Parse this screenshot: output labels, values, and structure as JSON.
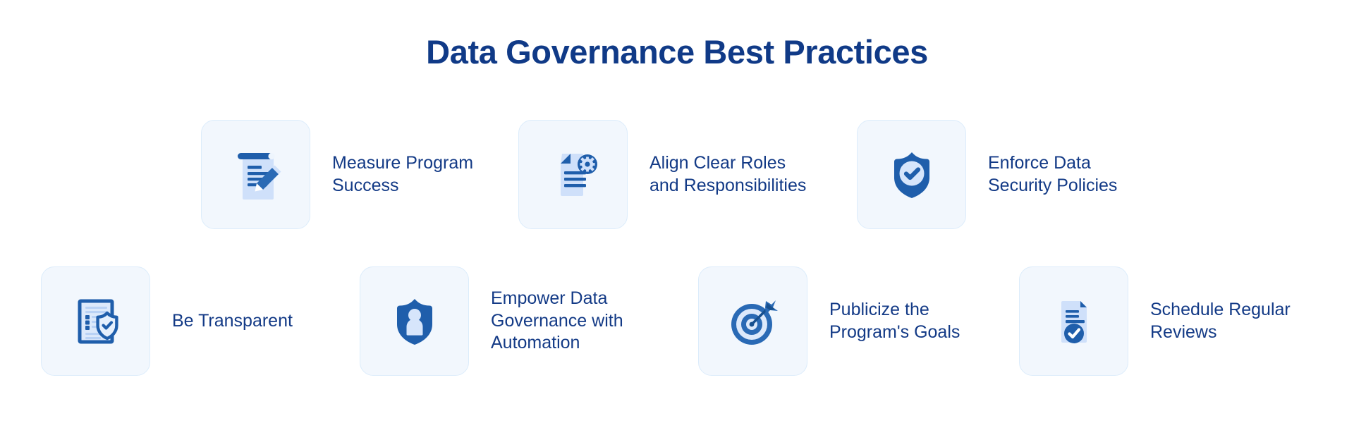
{
  "header": {
    "title": "Data Governance Best Practices"
  },
  "theme": {
    "title_color": "#103a87",
    "label_color": "#133a86",
    "card_background": "#f2f7fd",
    "card_border": "#dcecfb",
    "icon_primary": "#1f5eab",
    "icon_dark": "#17508f",
    "icon_light": "#cfe0fa",
    "page_background": "#ffffff"
  },
  "practices": [
    {
      "id": "measure-program-success",
      "label": "Measure Program\nSuccess",
      "icon": "document-pen-icon"
    },
    {
      "id": "align-clear-roles",
      "label": "Align Clear Roles\nand Responsibilities",
      "icon": "document-gear-icon"
    },
    {
      "id": "enforce-data-security",
      "label": "Enforce Data\nSecurity Policies",
      "icon": "shield-check-icon"
    },
    {
      "id": "be-transparent",
      "label": "Be Transparent",
      "icon": "document-shield-icon"
    },
    {
      "id": "empower-with-automation",
      "label": "Empower Data\nGovernance with\nAutomation",
      "icon": "shield-person-icon"
    },
    {
      "id": "publicize-program-goals",
      "label": "Publicize the\nProgram's Goals",
      "icon": "target-dart-icon"
    },
    {
      "id": "schedule-regular-reviews",
      "label": "Schedule Regular\nReviews",
      "icon": "document-check-icon"
    }
  ]
}
